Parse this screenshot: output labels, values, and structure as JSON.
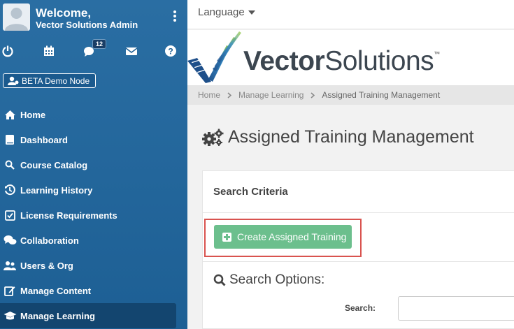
{
  "profile": {
    "welcome": "Welcome,",
    "name": "Vector Solutions Admin"
  },
  "icons": {
    "power": "power-icon",
    "calendar": "calendar-icon",
    "chat": "chat-icon",
    "mail": "mail-icon",
    "help": "help-icon"
  },
  "notifications": {
    "count": "12"
  },
  "beta": {
    "label": "BETA Demo Node"
  },
  "nav": {
    "items": [
      {
        "label": "Home",
        "icon": "home-icon"
      },
      {
        "label": "Dashboard",
        "icon": "book-icon"
      },
      {
        "label": "Course Catalog",
        "icon": "search-icon"
      },
      {
        "label": "Learning History",
        "icon": "history-icon"
      },
      {
        "label": "License Requirements",
        "icon": "checkbox-icon"
      },
      {
        "label": "Collaboration",
        "icon": "comments-icon"
      },
      {
        "label": "Users & Org",
        "icon": "users-icon"
      },
      {
        "label": "Manage Content",
        "icon": "edit-icon"
      },
      {
        "label": "Manage Learning",
        "icon": "graduation-cap-icon"
      }
    ]
  },
  "topbar": {
    "language": "Language"
  },
  "logo": {
    "bold": "Vector",
    "light": "Solutions",
    "tm": "™"
  },
  "breadcrumb": {
    "home": "Home",
    "section": "Manage Learning",
    "current": "Assigned Training Management"
  },
  "page": {
    "title": "Assigned Training Management"
  },
  "panel": {
    "header": "Search Criteria",
    "create_button": "Create Assigned Training",
    "search_options": "Search Options:",
    "search_label": "Search:",
    "search_value": ""
  },
  "colors": {
    "sidebar": "#1d5f94",
    "active_nav": "#13456f",
    "create_button": "#6cbf8d",
    "highlight": "#d9534f"
  }
}
